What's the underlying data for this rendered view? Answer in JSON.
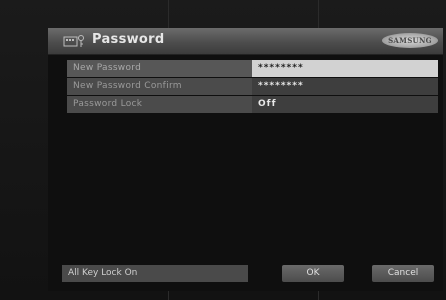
{
  "dialog": {
    "title": "Password",
    "brand": "SAMSUNG"
  },
  "rows": [
    {
      "label": "New Password",
      "value": "********"
    },
    {
      "label": "New Password Confirm",
      "value": "********"
    },
    {
      "label": "Password Lock",
      "value": "Off"
    }
  ],
  "footer": {
    "lock_label": "All Key Lock On",
    "ok_label": "OK",
    "cancel_label": "Cancel"
  },
  "icons": {
    "title_icon": "key-lock-icon"
  }
}
